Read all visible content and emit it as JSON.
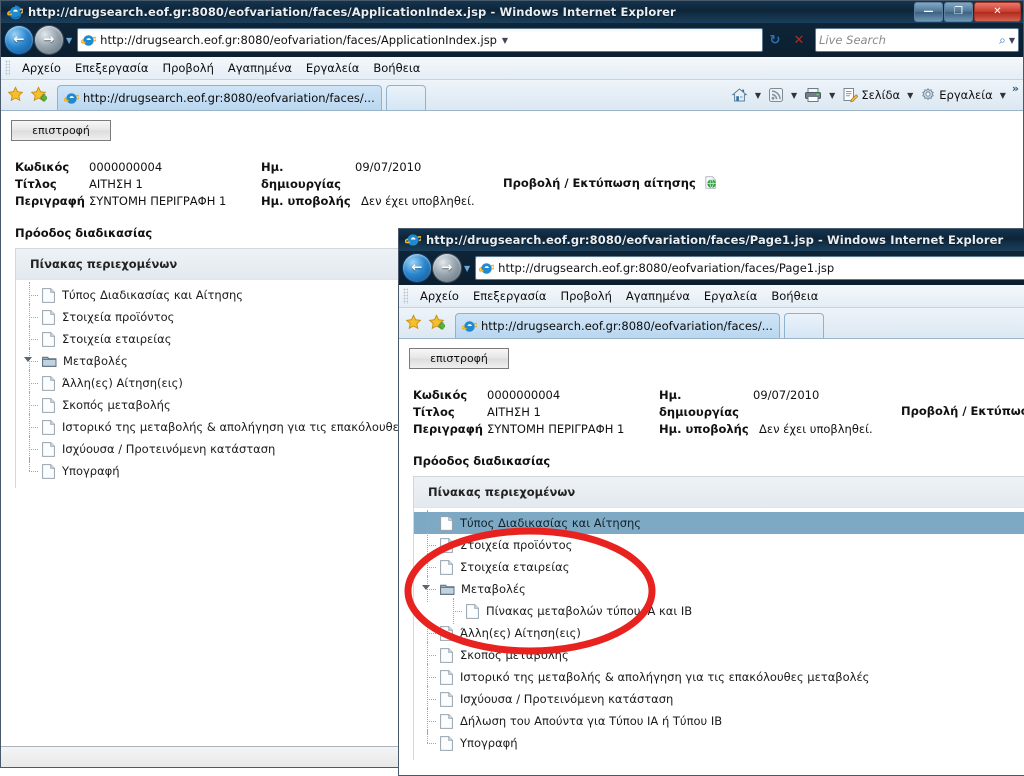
{
  "back_window": {
    "title": "http://drugsearch.eof.gr:8080/eofvariation/faces/ApplicationIndex.jsp - Windows Internet Explorer",
    "window_buttons": {
      "minimize": "—",
      "maximize": "❐",
      "close": "✕"
    },
    "address_value": "http://drugsearch.eof.gr:8080/eofvariation/faces/ApplicationIndex.jsp",
    "refresh_glyph": "↻",
    "stop_glyph": "✕",
    "search_placeholder": "Live Search",
    "menu": [
      "Αρχείο",
      "Επεξεργασία",
      "Προβολή",
      "Αγαπημένα",
      "Εργαλεία",
      "Βοήθεια"
    ],
    "tab_label": "http://drugsearch.eof.gr:8080/eofvariation/faces/...",
    "command_bar": {
      "page": "Σελίδα",
      "tools": "Εργαλεία",
      "overflow": "»"
    },
    "page": {
      "back_button": "επιστροφή",
      "fields": [
        {
          "key": "Κωδικός",
          "value": "0000000004"
        },
        {
          "key": "Τίτλος",
          "value": "ΑΙΤΗΣΗ 1"
        },
        {
          "key": "Περιγραφή",
          "value": "ΣΥΝΤΟΜΗ ΠΕΡΙΓΡΑΦΗ 1"
        }
      ],
      "dates": [
        {
          "key": "Ημ. δημιουργίας",
          "value": "09/07/2010"
        },
        {
          "key": "Ημ. υποβολής",
          "value": "Δεν έχει υποβληθεί."
        }
      ],
      "print_link": "Προβολή / Εκτύπωση αίτησης",
      "progress_label": "Πρόοδος διαδικασίας",
      "toc_header": "Πίνακας περιεχομένων",
      "tree": [
        {
          "label": "Τύπος Διαδικασίας και Αίτησης",
          "level": 1,
          "type": "doc",
          "selected": false
        },
        {
          "label": "Στοιχεία προϊόντος",
          "level": 1,
          "type": "doc",
          "selected": false
        },
        {
          "label": "Στοιχεία εταιρείας",
          "level": 1,
          "type": "doc",
          "selected": false
        },
        {
          "label": "Μεταβολές",
          "level": 1,
          "type": "folder",
          "selected": false
        },
        {
          "label": "Άλλη(ες) Αίτηση(εις)",
          "level": 1,
          "type": "doc",
          "selected": false
        },
        {
          "label": "Σκοπός μεταβολής",
          "level": 1,
          "type": "doc",
          "selected": false
        },
        {
          "label": "Ιστορικό της μεταβολής & απολήγηση για τις επακόλουθες μεταβολές",
          "level": 1,
          "type": "doc",
          "selected": false
        },
        {
          "label": "Ισχύουσα / Προτεινόμενη κατάσταση",
          "level": 1,
          "type": "doc",
          "selected": false
        },
        {
          "label": "Υπογραφή",
          "level": 1,
          "type": "doc",
          "selected": false
        }
      ]
    }
  },
  "front_window": {
    "title": "http://drugsearch.eof.gr:8080/eofvariation/faces/Page1.jsp - Windows Internet Explorer",
    "address_value": "http://drugsearch.eof.gr:8080/eofvariation/faces/Page1.jsp",
    "menu": [
      "Αρχείο",
      "Επεξεργασία",
      "Προβολή",
      "Αγαπημένα",
      "Εργαλεία",
      "Βοήθεια"
    ],
    "tab_label": "http://drugsearch.eof.gr:8080/eofvariation/faces/...",
    "page": {
      "back_button": "επιστροφή",
      "fields": [
        {
          "key": "Κωδικός",
          "value": "0000000004"
        },
        {
          "key": "Τίτλος",
          "value": "ΑΙΤΗΣΗ 1"
        },
        {
          "key": "Περιγραφή",
          "value": "ΣΥΝΤΟΜΗ ΠΕΡΙΓΡΑΦΗ 1"
        }
      ],
      "dates": [
        {
          "key": "Ημ. δημιουργίας",
          "value": "09/07/2010"
        },
        {
          "key": "Ημ. υποβολής",
          "value": "Δεν έχει υποβληθεί."
        }
      ],
      "print_link": "Προβολή / Εκτύπωσ",
      "progress_label": "Πρόοδος διαδικασίας",
      "toc_header": "Πίνακας περιεχομένων",
      "tree": [
        {
          "label": "Τύπος Διαδικασίας και Αίτησης",
          "level": 1,
          "type": "doc",
          "selected": true
        },
        {
          "label": "Στοιχεία προϊόντος",
          "level": 1,
          "type": "doc",
          "selected": false
        },
        {
          "label": "Στοιχεία εταιρείας",
          "level": 1,
          "type": "doc",
          "selected": false
        },
        {
          "label": "Μεταβολές",
          "level": 1,
          "type": "folder",
          "selected": false
        },
        {
          "label": "Πίνακας μεταβολών τύπου ΙΑ και ΙΒ",
          "level": 2,
          "type": "doc",
          "selected": false
        },
        {
          "label": "Άλλη(ες) Αίτηση(εις)",
          "level": 1,
          "type": "doc",
          "selected": false
        },
        {
          "label": "Σκοπός μεταβολής",
          "level": 1,
          "type": "doc",
          "selected": false
        },
        {
          "label": "Ιστορικό της μεταβολής & απολήγηση για τις επακόλουθες μεταβολές",
          "level": 1,
          "type": "doc",
          "selected": false
        },
        {
          "label": "Ισχύουσα / Προτεινόμενη κατάσταση",
          "level": 1,
          "type": "doc",
          "selected": false
        },
        {
          "label": "Δήλωση του Απούντα για Τύπου ΙΑ ή Τύπου ΙΒ",
          "level": 1,
          "type": "doc",
          "selected": false
        },
        {
          "label": "Υπογραφή",
          "level": 1,
          "type": "doc",
          "selected": false
        }
      ]
    }
  },
  "annotation": {
    "shape": "ellipse",
    "color": "#e8231f",
    "stroke_width": 7
  },
  "colors": {
    "titlebar": "#0d2438",
    "selected_row": "#7da9c4",
    "panel_header": "#e9eef3",
    "annotation_red": "#e8231f"
  }
}
